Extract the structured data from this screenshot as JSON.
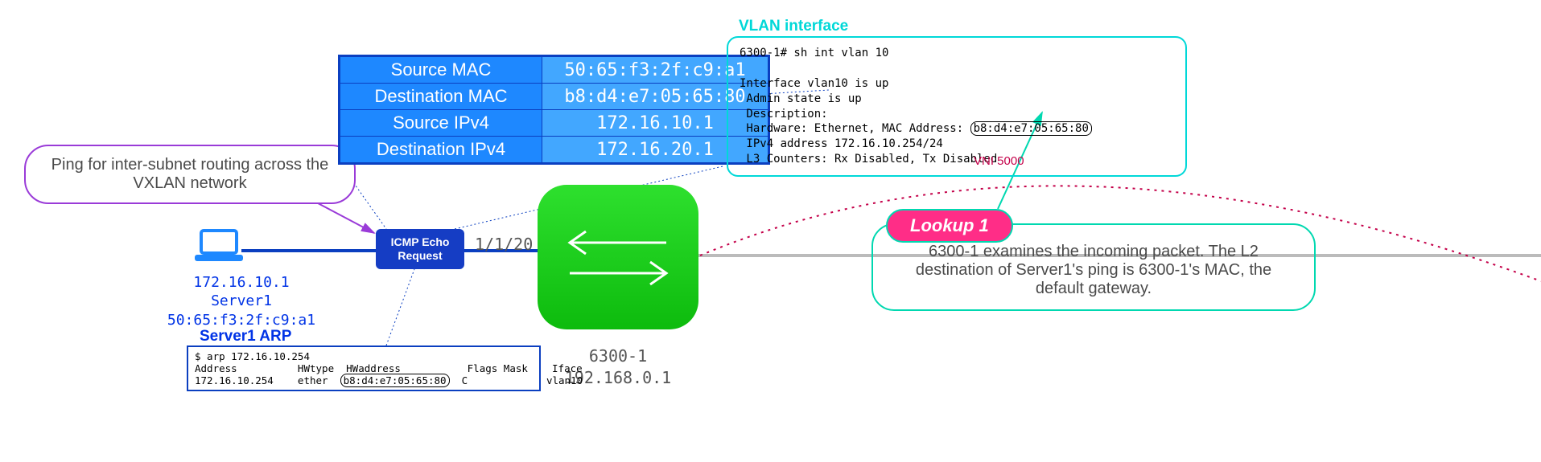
{
  "ping_note": "Ping for inter-subnet routing across the VXLAN network",
  "laptop": {
    "ip": "172.16.10.1",
    "name": "Server1",
    "mac": "50:65:f3:2f:c9:a1"
  },
  "icmp_label": "ICMP Echo Request",
  "port_label": "1/1/20",
  "packet": {
    "rows": [
      {
        "k": "Source MAC",
        "v": "50:65:f3:2f:c9:a1"
      },
      {
        "k": "Destination MAC",
        "v": "b8:d4:e7:05:65:80"
      },
      {
        "k": "Source IPv4",
        "v": "172.16.10.1"
      },
      {
        "k": "Destination IPv4",
        "v": "172.16.20.1"
      }
    ]
  },
  "switch": {
    "name": "6300-1",
    "ip": "192.168.0.1"
  },
  "arp": {
    "title": "Server1 ARP",
    "cmd": "$ arp 172.16.10.254",
    "hdr": "Address          HWtype  HWaddress           Flags Mask    Iface",
    "row_pre": "172.16.10.254    ether  ",
    "row_hl": "b8:d4:e7:05:65:80",
    "row_post": "  C             vlan10"
  },
  "vlan": {
    "title": "VLAN interface",
    "l1": "6300-1# sh int vlan 10",
    "l2": "Interface vlan10 is up",
    "l3": " Admin state is up",
    "l4": " Description:",
    "l5_pre": " Hardware: Ethernet, MAC Address: ",
    "l5_hl": "b8:d4:e7:05:65:80",
    "l6": " IPv4 address 172.16.10.254/24",
    "l7": " L3 Counters: Rx Disabled, Tx Disabled"
  },
  "lookup": {
    "badge": "Lookup 1",
    "text": "6300-1 examines the incoming packet. The L2 destination of Server1's ping is 6300-1's MAC, the default gateway."
  },
  "vni_label": "VNI 5000"
}
